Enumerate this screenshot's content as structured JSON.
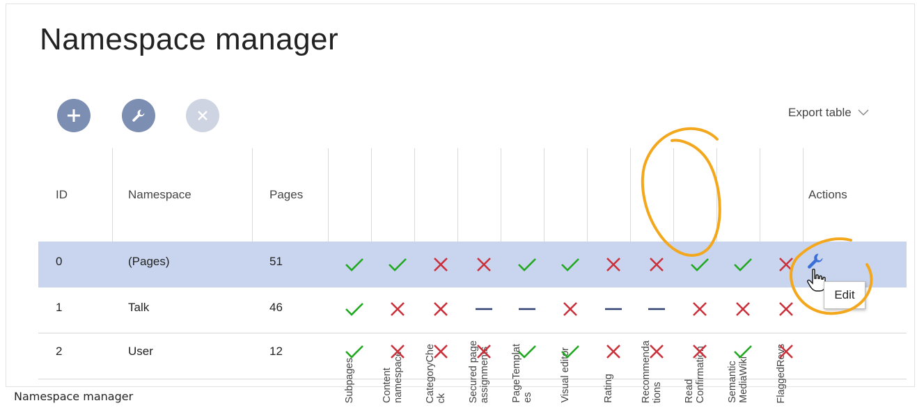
{
  "page": {
    "title": "Namespace manager",
    "caption": "Namespace manager"
  },
  "toolbar": {
    "add_icon": "plus-icon",
    "edit_icon": "wrench-icon",
    "delete_icon": "x-icon",
    "export_label": "Export table",
    "accent_color": "#7d8eb3",
    "disabled_color": "#cfd4e2"
  },
  "table": {
    "headers": {
      "id": "ID",
      "namespace": "Namespace",
      "pages": "Pages",
      "features": [
        "Subpages",
        "Content namespace",
        "CategoryCheck",
        "Secured page assignments",
        "PageTemplates",
        "Visual editor",
        "Rating",
        "Recommendations",
        "Read Confirmation",
        "Semantic MediaWiki",
        "FlaggedRevs"
      ],
      "feature_labels": [
        [
          "Subpages"
        ],
        [
          "Content",
          "namespace"
        ],
        [
          "CategoryChe",
          "ck"
        ],
        [
          "Secured page",
          "assignments"
        ],
        [
          "PageTemplat",
          "es"
        ],
        [
          "Visual editor"
        ],
        [
          "Rating"
        ],
        [
          "Recommenda",
          "tions"
        ],
        [
          "Read",
          "Confirmation"
        ],
        [
          "Semantic",
          "MediaWiki"
        ],
        [
          "FlaggedRevs"
        ]
      ],
      "actions": "Actions"
    },
    "rows": [
      {
        "id": "0",
        "namespace": "(Pages)",
        "pages": "51",
        "flags": [
          "yes",
          "yes",
          "no",
          "no",
          "yes",
          "yes",
          "no",
          "no",
          "yes",
          "yes",
          "no"
        ],
        "selected": true
      },
      {
        "id": "1",
        "namespace": "Talk",
        "pages": "46",
        "flags": [
          "yes",
          "no",
          "no",
          "na",
          "na",
          "no",
          "na",
          "na",
          "no",
          "no",
          "no"
        ],
        "selected": false
      },
      {
        "id": "2",
        "namespace": "User",
        "pages": "12",
        "flags": [
          "yes",
          "no",
          "no",
          "no",
          "yes",
          "yes",
          "no",
          "no",
          "no",
          "yes",
          "no"
        ],
        "selected": false
      }
    ],
    "colors": {
      "yes": "#22a822",
      "no": "#c9313b",
      "na": "#2f3f6f",
      "selected_row": "#c9d5ee"
    }
  },
  "action": {
    "icon": "wrench-icon",
    "cursor_icon": "hand-cursor-icon",
    "tooltip": "Edit",
    "icon_color": "#3a6fd8"
  },
  "annotation_color": "#f3a71c"
}
